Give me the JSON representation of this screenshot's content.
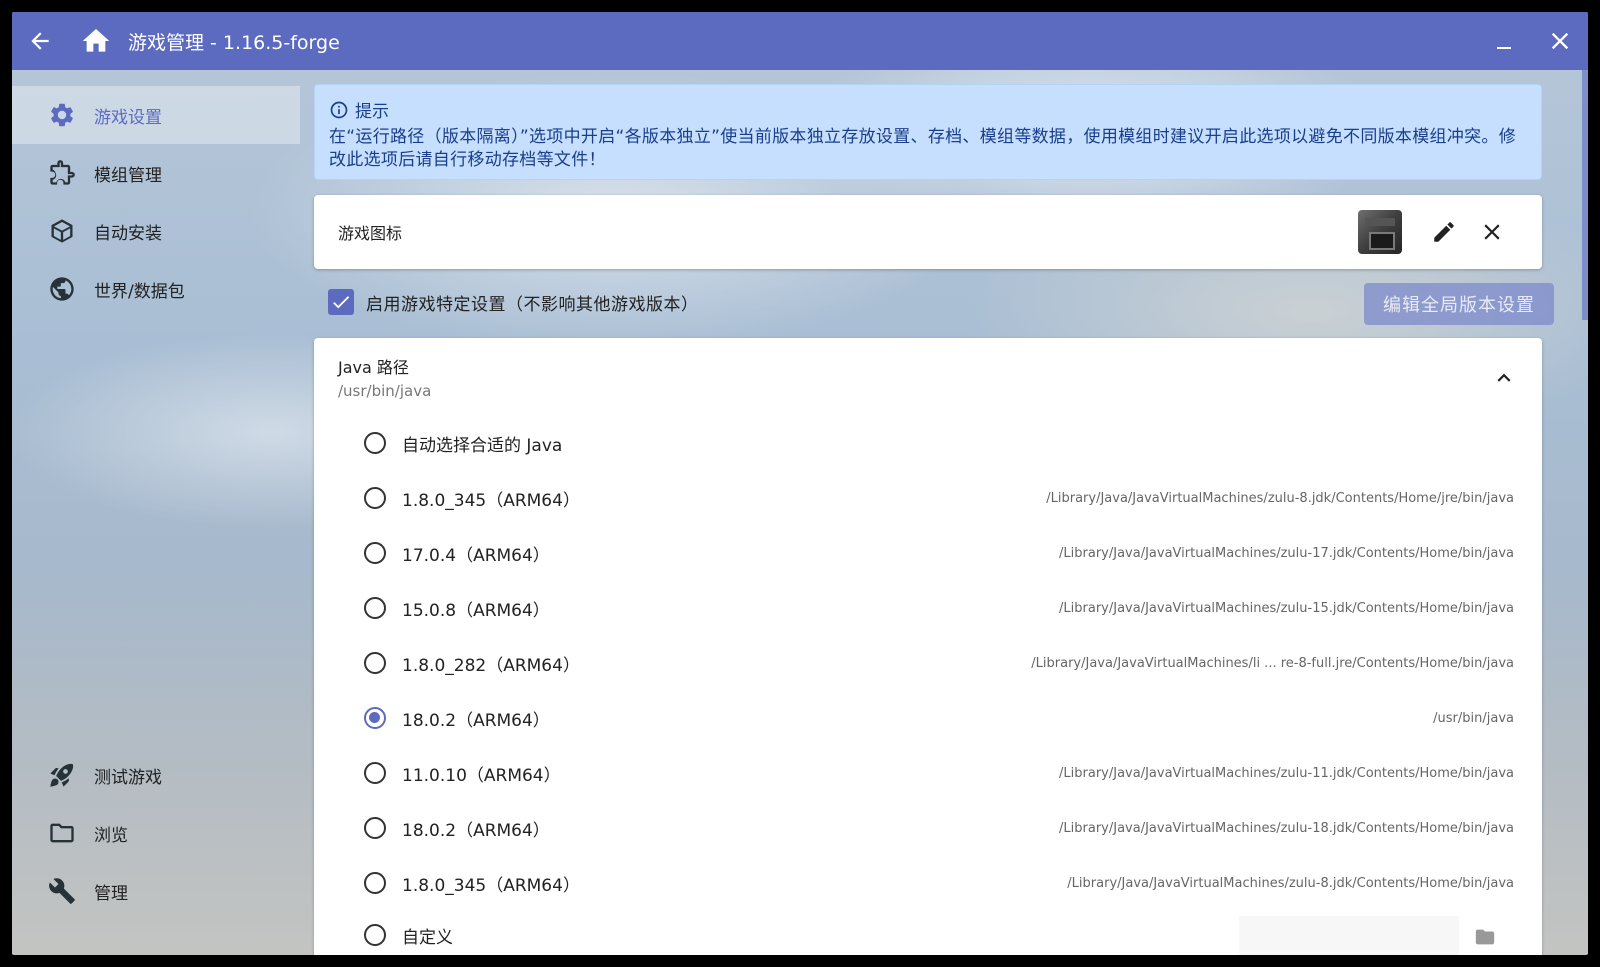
{
  "window": {
    "title": "游戏管理 - 1.16.5-forge",
    "icons": {
      "back": "arrow-left-icon",
      "home": "home-icon",
      "minimize": "minimize-icon",
      "close": "close-icon"
    },
    "accent": "#5c6bc0"
  },
  "sidebar": {
    "items": [
      {
        "label": "游戏设置",
        "icon": "gear-icon",
        "active": true
      },
      {
        "label": "模组管理",
        "icon": "puzzle-icon"
      },
      {
        "label": "自动安装",
        "icon": "package-icon"
      },
      {
        "label": "世界/数据包",
        "icon": "globe-icon"
      },
      {
        "label": "测试游戏",
        "icon": "rocket-icon"
      },
      {
        "label": "浏览",
        "icon": "folder-icon"
      },
      {
        "label": "管理",
        "icon": "wrench-icon"
      }
    ]
  },
  "tip": {
    "title": "提示",
    "body": "在“运行路径（版本隔离）”选项中开启“各版本独立”使当前版本独立存放设置、存档、模组等数据，使用模组时建议开启此选项以避免不同版本模组冲突。修改此选项后请自行移动存档等文件！"
  },
  "game_icon": {
    "label": "游戏图标"
  },
  "specific_settings": {
    "label": "启用游戏特定设置（不影响其他游戏版本）",
    "checked": true,
    "global_button": "编辑全局版本设置"
  },
  "java": {
    "title": "Java 路径",
    "current": "/usr/bin/java",
    "options": [
      {
        "name": "自动选择合适的 Java",
        "path": ""
      },
      {
        "name": "1.8.0_345（ARM64）",
        "path": "/Library/Java/JavaVirtualMachines/zulu-8.jdk/Contents/Home/jre/bin/java"
      },
      {
        "name": "17.0.4（ARM64）",
        "path": "/Library/Java/JavaVirtualMachines/zulu-17.jdk/Contents/Home/bin/java"
      },
      {
        "name": "15.0.8（ARM64）",
        "path": "/Library/Java/JavaVirtualMachines/zulu-15.jdk/Contents/Home/bin/java"
      },
      {
        "name": "1.8.0_282（ARM64）",
        "path": "/Library/Java/JavaVirtualMachines/li ... re-8-full.jre/Contents/Home/bin/java"
      },
      {
        "name": "18.0.2（ARM64）",
        "path": "/usr/bin/java",
        "selected": true
      },
      {
        "name": "11.0.10（ARM64）",
        "path": "/Library/Java/JavaVirtualMachines/zulu-11.jdk/Contents/Home/bin/java"
      },
      {
        "name": "18.0.2（ARM64）",
        "path": "/Library/Java/JavaVirtualMachines/zulu-18.jdk/Contents/Home/bin/java"
      },
      {
        "name": "1.8.0_345（ARM64）",
        "path": "/Library/Java/JavaVirtualMachines/zulu-8.jdk/Contents/Home/bin/java"
      },
      {
        "name": "自定义",
        "path": ""
      }
    ]
  }
}
